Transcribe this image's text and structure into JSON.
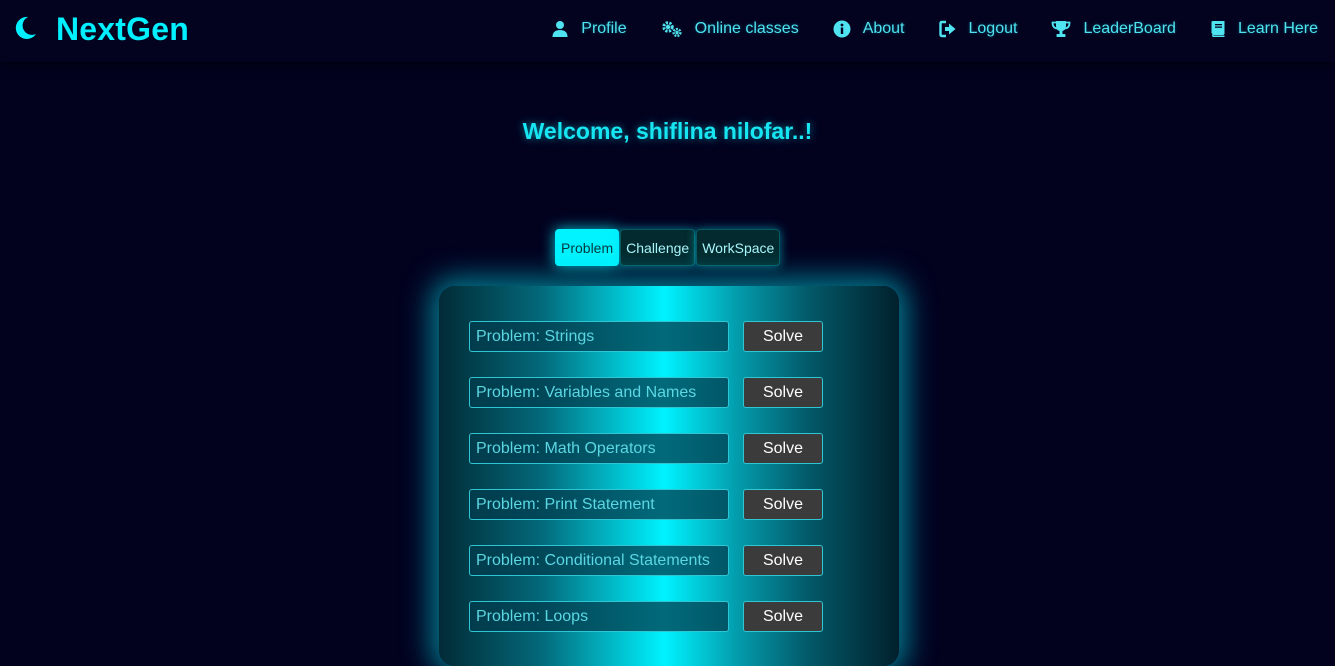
{
  "brand": {
    "name": "NextGen",
    "theme_icon": "moon-icon"
  },
  "nav": {
    "items": [
      {
        "label": "Profile",
        "icon": "user-icon"
      },
      {
        "label": "Online classes",
        "icon": "gears-icon"
      },
      {
        "label": "About",
        "icon": "info-icon"
      },
      {
        "label": "Logout",
        "icon": "logout-icon"
      },
      {
        "label": "LeaderBoard",
        "icon": "trophy-icon"
      },
      {
        "label": "Learn Here",
        "icon": "book-icon"
      }
    ]
  },
  "welcome": {
    "text": "Welcome, shiflina nilofar..!"
  },
  "tabs": [
    {
      "label": "Problem",
      "active": true
    },
    {
      "label": "Challenge",
      "active": false
    },
    {
      "label": "WorkSpace",
      "active": false
    }
  ],
  "problems": [
    {
      "placeholder": "Problem: Strings",
      "button": "Solve"
    },
    {
      "placeholder": "Problem: Variables and Names",
      "button": "Solve"
    },
    {
      "placeholder": "Problem: Math Operators",
      "button": "Solve"
    },
    {
      "placeholder": "Problem: Print Statement",
      "button": "Solve"
    },
    {
      "placeholder": "Problem: Conditional Statements",
      "button": "Solve"
    },
    {
      "placeholder": "Problem: Loops",
      "button": "Solve"
    }
  ],
  "colors": {
    "background": "#02021f",
    "accent": "#00f0ff",
    "button_bg": "#3b3b3b"
  }
}
